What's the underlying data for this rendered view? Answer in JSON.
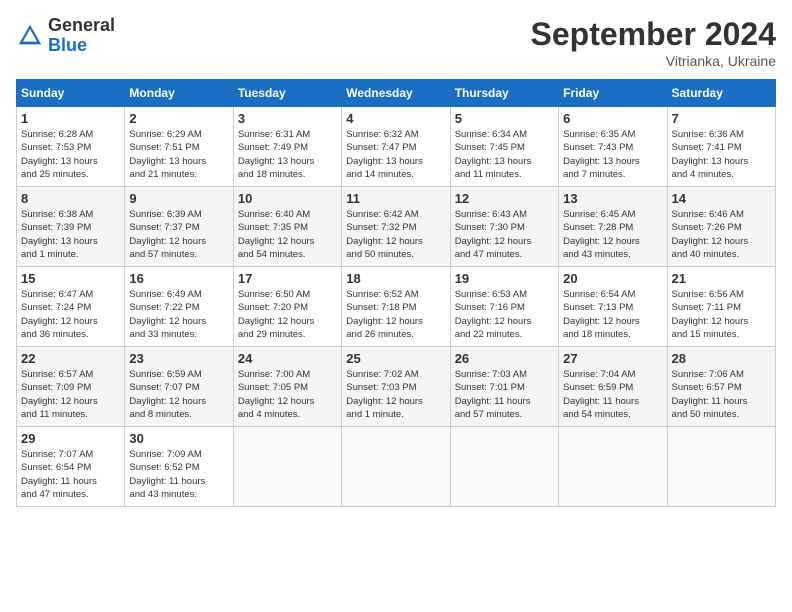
{
  "logo": {
    "general": "General",
    "blue": "Blue"
  },
  "title": "September 2024",
  "location": "Vitrianka, Ukraine",
  "days_header": [
    "Sunday",
    "Monday",
    "Tuesday",
    "Wednesday",
    "Thursday",
    "Friday",
    "Saturday"
  ],
  "weeks": [
    [
      {
        "day": "1",
        "info": "Sunrise: 6:28 AM\nSunset: 7:53 PM\nDaylight: 13 hours\nand 25 minutes."
      },
      {
        "day": "2",
        "info": "Sunrise: 6:29 AM\nSunset: 7:51 PM\nDaylight: 13 hours\nand 21 minutes."
      },
      {
        "day": "3",
        "info": "Sunrise: 6:31 AM\nSunset: 7:49 PM\nDaylight: 13 hours\nand 18 minutes."
      },
      {
        "day": "4",
        "info": "Sunrise: 6:32 AM\nSunset: 7:47 PM\nDaylight: 13 hours\nand 14 minutes."
      },
      {
        "day": "5",
        "info": "Sunrise: 6:34 AM\nSunset: 7:45 PM\nDaylight: 13 hours\nand 11 minutes."
      },
      {
        "day": "6",
        "info": "Sunrise: 6:35 AM\nSunset: 7:43 PM\nDaylight: 13 hours\nand 7 minutes."
      },
      {
        "day": "7",
        "info": "Sunrise: 6:36 AM\nSunset: 7:41 PM\nDaylight: 13 hours\nand 4 minutes."
      }
    ],
    [
      {
        "day": "8",
        "info": "Sunrise: 6:38 AM\nSunset: 7:39 PM\nDaylight: 13 hours\nand 1 minute."
      },
      {
        "day": "9",
        "info": "Sunrise: 6:39 AM\nSunset: 7:37 PM\nDaylight: 12 hours\nand 57 minutes."
      },
      {
        "day": "10",
        "info": "Sunrise: 6:40 AM\nSunset: 7:35 PM\nDaylight: 12 hours\nand 54 minutes."
      },
      {
        "day": "11",
        "info": "Sunrise: 6:42 AM\nSunset: 7:32 PM\nDaylight: 12 hours\nand 50 minutes."
      },
      {
        "day": "12",
        "info": "Sunrise: 6:43 AM\nSunset: 7:30 PM\nDaylight: 12 hours\nand 47 minutes."
      },
      {
        "day": "13",
        "info": "Sunrise: 6:45 AM\nSunset: 7:28 PM\nDaylight: 12 hours\nand 43 minutes."
      },
      {
        "day": "14",
        "info": "Sunrise: 6:46 AM\nSunset: 7:26 PM\nDaylight: 12 hours\nand 40 minutes."
      }
    ],
    [
      {
        "day": "15",
        "info": "Sunrise: 6:47 AM\nSunset: 7:24 PM\nDaylight: 12 hours\nand 36 minutes."
      },
      {
        "day": "16",
        "info": "Sunrise: 6:49 AM\nSunset: 7:22 PM\nDaylight: 12 hours\nand 33 minutes."
      },
      {
        "day": "17",
        "info": "Sunrise: 6:50 AM\nSunset: 7:20 PM\nDaylight: 12 hours\nand 29 minutes."
      },
      {
        "day": "18",
        "info": "Sunrise: 6:52 AM\nSunset: 7:18 PM\nDaylight: 12 hours\nand 26 minutes."
      },
      {
        "day": "19",
        "info": "Sunrise: 6:53 AM\nSunset: 7:16 PM\nDaylight: 12 hours\nand 22 minutes."
      },
      {
        "day": "20",
        "info": "Sunrise: 6:54 AM\nSunset: 7:13 PM\nDaylight: 12 hours\nand 18 minutes."
      },
      {
        "day": "21",
        "info": "Sunrise: 6:56 AM\nSunset: 7:11 PM\nDaylight: 12 hours\nand 15 minutes."
      }
    ],
    [
      {
        "day": "22",
        "info": "Sunrise: 6:57 AM\nSunset: 7:09 PM\nDaylight: 12 hours\nand 11 minutes."
      },
      {
        "day": "23",
        "info": "Sunrise: 6:59 AM\nSunset: 7:07 PM\nDaylight: 12 hours\nand 8 minutes."
      },
      {
        "day": "24",
        "info": "Sunrise: 7:00 AM\nSunset: 7:05 PM\nDaylight: 12 hours\nand 4 minutes."
      },
      {
        "day": "25",
        "info": "Sunrise: 7:02 AM\nSunset: 7:03 PM\nDaylight: 12 hours\nand 1 minute."
      },
      {
        "day": "26",
        "info": "Sunrise: 7:03 AM\nSunset: 7:01 PM\nDaylight: 11 hours\nand 57 minutes."
      },
      {
        "day": "27",
        "info": "Sunrise: 7:04 AM\nSunset: 6:59 PM\nDaylight: 11 hours\nand 54 minutes."
      },
      {
        "day": "28",
        "info": "Sunrise: 7:06 AM\nSunset: 6:57 PM\nDaylight: 11 hours\nand 50 minutes."
      }
    ],
    [
      {
        "day": "29",
        "info": "Sunrise: 7:07 AM\nSunset: 6:54 PM\nDaylight: 11 hours\nand 47 minutes."
      },
      {
        "day": "30",
        "info": "Sunrise: 7:09 AM\nSunset: 6:52 PM\nDaylight: 11 hours\nand 43 minutes."
      },
      {
        "day": "",
        "info": ""
      },
      {
        "day": "",
        "info": ""
      },
      {
        "day": "",
        "info": ""
      },
      {
        "day": "",
        "info": ""
      },
      {
        "day": "",
        "info": ""
      }
    ]
  ]
}
